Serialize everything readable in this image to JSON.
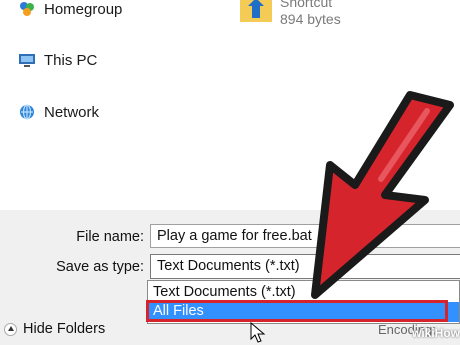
{
  "nav": {
    "items": [
      {
        "label": "Homegroup",
        "icon": "homegroup-icon"
      },
      {
        "label": "This PC",
        "icon": "pc-icon"
      },
      {
        "label": "Network",
        "icon": "network-icon"
      }
    ]
  },
  "file_list": {
    "item": {
      "name": "Shortcut",
      "size": "894 bytes",
      "icon": "folder-shortcut-icon"
    }
  },
  "dialog": {
    "file_name_label": "File name:",
    "file_name_value": "Play a game for free.bat",
    "save_type_label": "Save as type:",
    "save_type_value": "Text Documents (*.txt)",
    "options": [
      "Text Documents (*.txt)",
      "All Files"
    ],
    "selected_option_index": 1,
    "hide_folders_label": "Hide Folders",
    "encoding_label": "Encoding:"
  },
  "watermark": "wikiHow",
  "colors": {
    "selection": "#3390ff",
    "highlight_border": "#d6242d",
    "arrow_fill": "#d6242d"
  }
}
